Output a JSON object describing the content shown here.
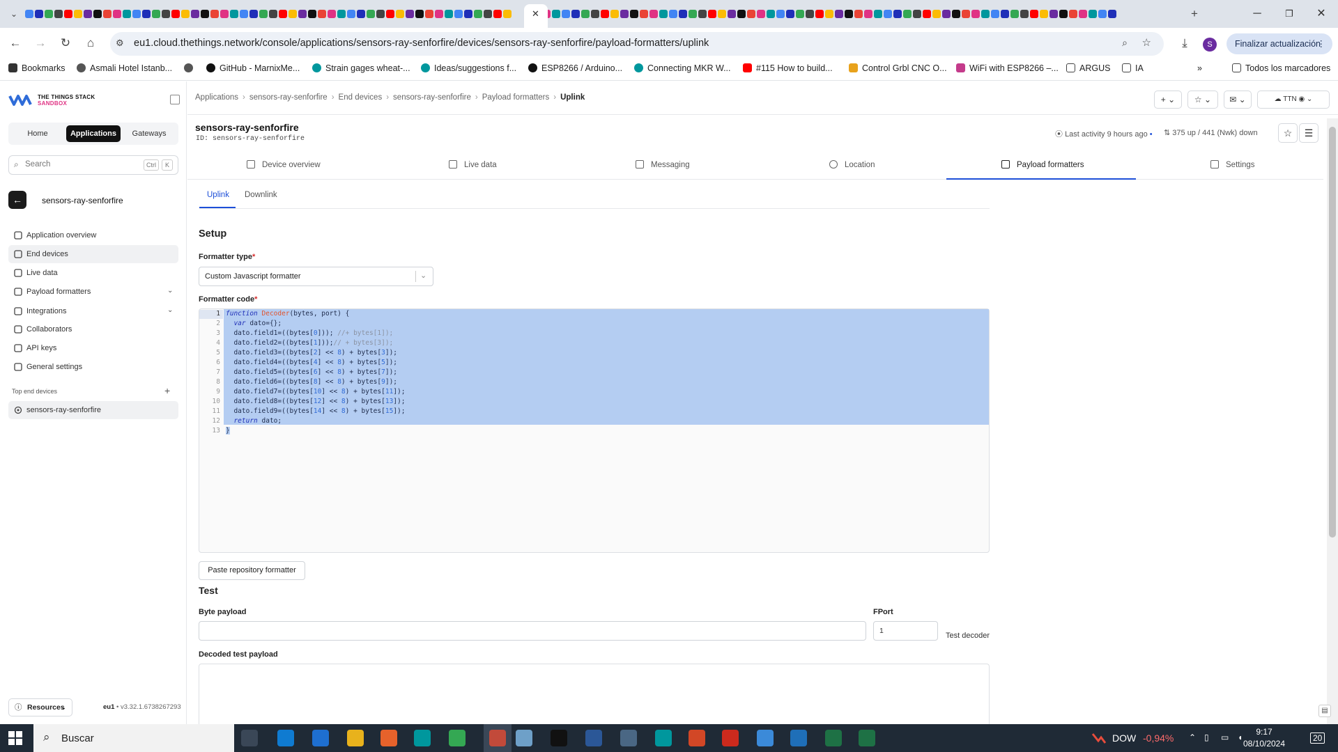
{
  "browser": {
    "url": "eu1.cloud.thethings.network/console/applications/sensors-ray-senforfire/devices/sensors-ray-senforfire/payload-formatters/uplink",
    "update_button": "Finalizar actualización",
    "profile_initial": "S",
    "bookmarks": [
      {
        "label": "Bookmarks",
        "icon": "star-icon",
        "color": "#333333"
      },
      {
        "label": "Asmali Hotel Istanb...",
        "icon": "globe-icon",
        "color": "#555555"
      },
      {
        "label": "",
        "icon": "globe-icon",
        "color": "#555555"
      },
      {
        "label": "GitHub - MarnixMe...",
        "icon": "github-icon",
        "color": "#111111"
      },
      {
        "label": "Strain gages wheat-...",
        "icon": "arduino-icon",
        "color": "#00979d"
      },
      {
        "label": "Ideas/suggestions f...",
        "icon": "arduino-icon",
        "color": "#00979d"
      },
      {
        "label": "ESP8266 / Arduino...",
        "icon": "github-icon",
        "color": "#111111"
      },
      {
        "label": "Connecting MKR W...",
        "icon": "arduino-icon",
        "color": "#00979d"
      },
      {
        "label": "#115 How to build...",
        "icon": "youtube-icon",
        "color": "#ff0000"
      },
      {
        "label": "Control Grbl CNC O...",
        "icon": "bookmark-icon",
        "color": "#e8a21c"
      },
      {
        "label": "WiFi with ESP8266 –...",
        "icon": "bookmark-icon",
        "color": "#c43b8b"
      },
      {
        "label": "ARGUS",
        "icon": "folder-icon",
        "color": "#444444"
      },
      {
        "label": "IA",
        "icon": "folder-icon",
        "color": "#444444"
      }
    ],
    "all_bookmarks": "Todos los marcadores"
  },
  "sidebar": {
    "logo_line1": "THE THINGS STACK",
    "logo_line2": "SANDBOX",
    "nav": [
      "Home",
      "Applications",
      "Gateways"
    ],
    "search_placeholder": "Search",
    "search_kbd": [
      "Ctrl",
      "K"
    ],
    "app_name": "sensors-ray-senforfire",
    "items": [
      {
        "label": "Application overview",
        "icon": "grid-icon"
      },
      {
        "label": "End devices",
        "icon": "devices-icon"
      },
      {
        "label": "Live data",
        "icon": "list-icon"
      },
      {
        "label": "Payload formatters",
        "icon": "code-icon",
        "expandable": true
      },
      {
        "label": "Integrations",
        "icon": "integrations-icon",
        "expandable": true
      },
      {
        "label": "Collaborators",
        "icon": "people-icon"
      },
      {
        "label": "API keys",
        "icon": "key-icon"
      },
      {
        "label": "General settings",
        "icon": "gear-icon"
      }
    ],
    "top_devices_label": "Top end devices",
    "top_device": "sensors-ray-senforfire",
    "resources": "Resources",
    "cluster": "eu1",
    "version": "v3.32.1.6738267293"
  },
  "header": {
    "breadcrumb": [
      "Applications",
      "sensors-ray-senforfire",
      "End devices",
      "sensors-ray-senforfire",
      "Payload formatters",
      "Uplink"
    ],
    "device_title": "sensors-ray-senforfire",
    "device_id": "ID: sensors-ray-senforfire",
    "last_activity": "Last activity 9 hours ago",
    "traffic": "375 up / 441 (Nwk) down"
  },
  "device_tabs": [
    "Device overview",
    "Live data",
    "Messaging",
    "Location",
    "Payload formatters",
    "Settings"
  ],
  "sub_tabs": [
    "Uplink",
    "Downlink"
  ],
  "setup": {
    "heading": "Setup",
    "formatter_type_label": "Formatter type",
    "formatter_type_value": "Custom Javascript formatter",
    "formatter_code_label": "Formatter code",
    "code_lines": [
      "function Decoder(bytes, port) {",
      "  var dato={};",
      "  dato.field1=((bytes[0])); //+ bytes[1]);",
      "  dato.field2=((bytes[1]));// + bytes[3]);",
      "  dato.field3=((bytes[2] << 8) + bytes[3]);",
      "  dato.field4=((bytes[4] << 8) + bytes[5]);",
      "  dato.field5=((bytes[6] << 8) + bytes[7]);",
      "  dato.field6=((bytes[8] << 8) + bytes[9]);",
      "  dato.field7=((bytes[10] << 8) + bytes[11]);",
      "  dato.field8=((bytes[12] << 8) + bytes[13]);",
      "  dato.field9=((bytes[14] << 8) + bytes[15]);",
      "  return dato;",
      "}"
    ],
    "paste_button": "Paste repository formatter"
  },
  "test": {
    "heading": "Test",
    "byte_payload_label": "Byte payload",
    "fport_label": "FPort",
    "fport_value": "1",
    "test_button": "Test decoder",
    "decoded_label": "Decoded test payload"
  },
  "taskbar": {
    "search": "Buscar",
    "stock_name": "DOW",
    "stock_change": "-0,94%",
    "time": "9:17",
    "date": "08/10/2024",
    "notifications": "20"
  },
  "colors": {
    "accent": "#1d4fd8",
    "selection": "#b4cdf2",
    "brand_pink": "#e03384"
  }
}
